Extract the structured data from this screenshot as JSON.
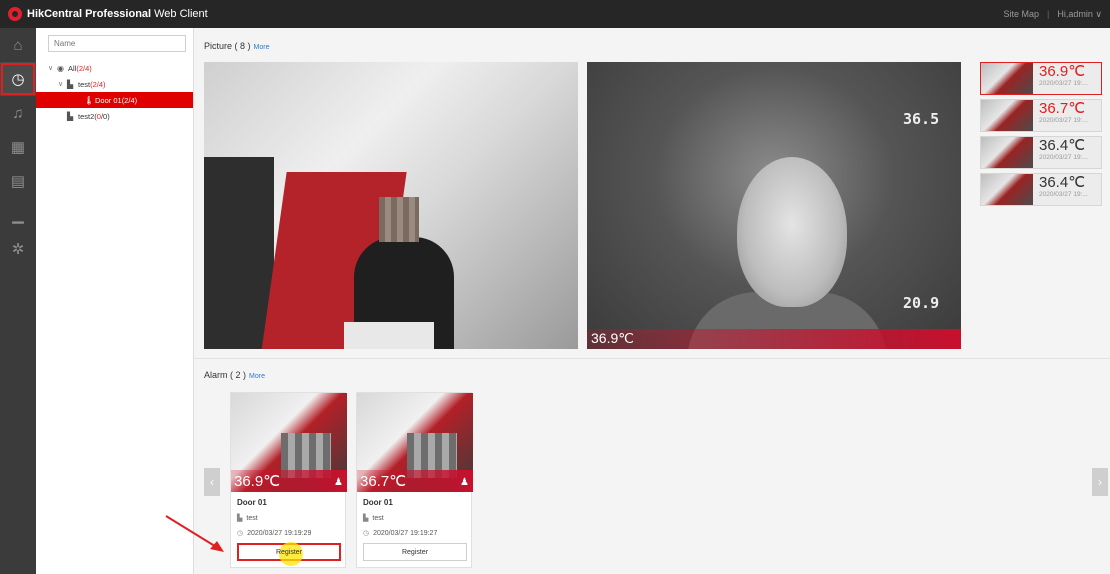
{
  "app": {
    "title_bold": "HikCentral Professional",
    "title_light": "Web Client"
  },
  "topbar": {
    "site_map": "Site Map",
    "separator": "|",
    "user": "Hi,admin"
  },
  "rail": {
    "icons": [
      "home-icon",
      "dashboard-icon",
      "alarm-bell-icon",
      "calendar-icon",
      "report-icon",
      "chart-icon",
      "settings-icon"
    ],
    "active_index": 1
  },
  "tree": {
    "search_placeholder": "Name",
    "nodes": [
      {
        "label": "All",
        "count": "(2/4)",
        "expand": "∨"
      },
      {
        "label": "test",
        "count": "(2/4)",
        "expand": "∨"
      },
      {
        "label": "Door 01",
        "count": "(2/4)",
        "selected": true
      },
      {
        "label": "test2",
        "count_gray": "(",
        "count_red": "0",
        "count_tail": "/0)"
      }
    ]
  },
  "picture": {
    "title": "Picture ( 8 )",
    "more": "More",
    "thermal_temp": "36.9℃",
    "thermal_label_top": "36.5",
    "thermal_label_bottom": "20.9",
    "thumbs": [
      {
        "temp": "36.9℃",
        "time": "2020/03/27 19:...",
        "alert": true
      },
      {
        "temp": "36.7℃",
        "time": "2020/03/27 19:...",
        "alert": true
      },
      {
        "temp": "36.4℃",
        "time": "2020/03/27 19:...",
        "alert": false
      },
      {
        "temp": "36.4℃",
        "time": "2020/03/27 19:...",
        "alert": false
      }
    ]
  },
  "alarm": {
    "title": "Alarm ( 2 )",
    "more": "More",
    "cards": [
      {
        "temp": "36.9℃",
        "door": "Door 01",
        "group": "test",
        "time": "2020/03/27 19:19:29",
        "register": "Register"
      },
      {
        "temp": "36.7℃",
        "door": "Door 01",
        "group": "test",
        "time": "2020/03/27 19:19:27",
        "register": "Register"
      }
    ]
  },
  "colors": {
    "accent": "#e02020",
    "topbar": "#262626",
    "rail": "#3b3b3b",
    "link": "#2b7bd6"
  }
}
